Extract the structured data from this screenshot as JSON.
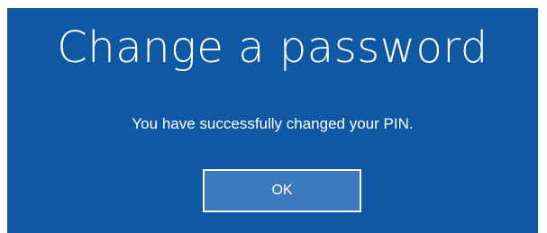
{
  "dialog": {
    "title": "Change a password",
    "message": "You have successfully changed your PIN.",
    "ok_label": "OK"
  },
  "colors": {
    "background": "#0e58a4",
    "text": "#ffffff",
    "button_fill": "#3b7bbd",
    "button_border": "#ffffff"
  }
}
